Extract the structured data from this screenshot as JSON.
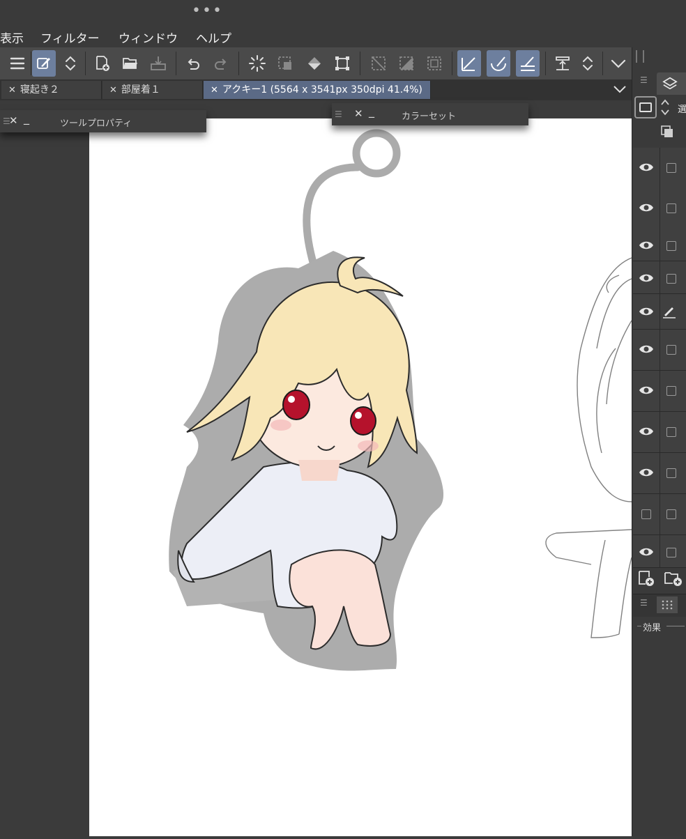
{
  "window": {
    "dots": "•••"
  },
  "menu": {
    "items": [
      "表示",
      "フィルター",
      "ウィンドウ",
      "ヘルプ"
    ]
  },
  "toolbar": {
    "buttons": [
      {
        "name": "menu-icon",
        "active": false
      },
      {
        "name": "tool-shortcut-icon",
        "active": true
      },
      {
        "name": "updown-icon",
        "active": false
      },
      {
        "name": "new-document-icon",
        "active": false
      },
      {
        "name": "open-folder-icon",
        "active": false
      },
      {
        "name": "save-icon",
        "active": false
      },
      {
        "name": "undo-icon",
        "active": false
      },
      {
        "name": "redo-icon",
        "active": false
      },
      {
        "name": "select-all-icon",
        "active": false
      },
      {
        "name": "deselect-icon",
        "active": false
      },
      {
        "name": "fill-icon",
        "active": false
      },
      {
        "name": "transform-icon",
        "active": false
      },
      {
        "name": "clear-outside-icon",
        "active": false
      },
      {
        "name": "fill-selection-icon",
        "active": false
      },
      {
        "name": "show-selection-icon",
        "active": false
      },
      {
        "name": "snap-ruler-icon",
        "active": true
      },
      {
        "name": "snap-special-ruler-icon",
        "active": true
      },
      {
        "name": "snap-grid-icon",
        "active": true
      },
      {
        "name": "transfer-icon",
        "active": false
      },
      {
        "name": "updown-icon",
        "active": false
      },
      {
        "name": "chevron-down-icon",
        "active": false
      }
    ]
  },
  "tabs": [
    {
      "label": "寝起き２",
      "active": false
    },
    {
      "label": "部屋着１",
      "active": false
    },
    {
      "label": "アクキー1 (5564 x 3541px 350dpi 41.4%)",
      "active": true
    }
  ],
  "palettes": {
    "tool_property": {
      "title": "ツールプロパティ"
    },
    "color_set": {
      "title": "カラーセット"
    }
  },
  "right_panel": {
    "tab_label": "選",
    "layers": [
      {
        "visible": true,
        "editing": false
      },
      {
        "visible": true,
        "editing": false
      },
      {
        "visible": true,
        "editing": false
      },
      {
        "visible": true,
        "editing": false
      },
      {
        "visible": true,
        "editing": true
      },
      {
        "visible": true,
        "editing": false
      },
      {
        "visible": true,
        "editing": false
      },
      {
        "visible": true,
        "editing": false
      },
      {
        "visible": true,
        "editing": false
      },
      {
        "visible": false,
        "editing": false
      },
      {
        "visible": true,
        "editing": false
      }
    ],
    "effects_label": "効果"
  },
  "colors": {
    "active_tab": "#5b6a86",
    "active_tool": "#6d7f9e",
    "panel_bg": "#3a3a3a",
    "canvas": "#ffffff"
  }
}
